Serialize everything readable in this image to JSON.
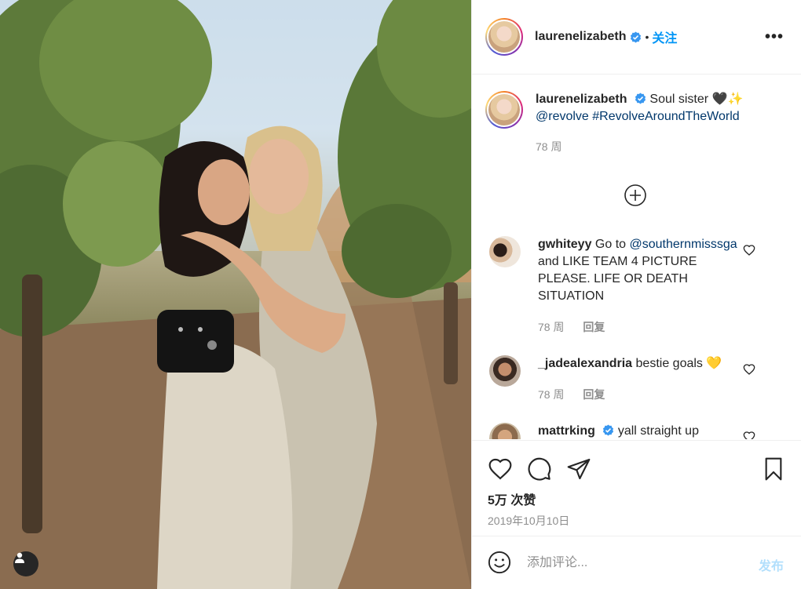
{
  "post": {
    "username": "laurenelizabeth",
    "dot": "•",
    "follow_label": "关注",
    "more_label": "•••"
  },
  "caption": {
    "username": "laurenelizabeth",
    "text": "Soul sister",
    "emojis": "🖤✨",
    "mention": "@revolve",
    "hashtag": "#RevolveAroundTheWorld",
    "time": "78 周"
  },
  "comments": [
    {
      "username": "gwhiteyy",
      "text_before": "Go to",
      "mention": "@southernmisssga",
      "text_after": "and LIKE TEAM 4 PICTURE PLEASE. LIFE OR DEATH SITUATION",
      "time": "78 周",
      "reply": "回复"
    },
    {
      "username": "_jadealexandria",
      "text": "bestie goals",
      "emoji": "💛",
      "time": "78 周",
      "reply": "回复"
    },
    {
      "username": "mattrking",
      "text": "yall straight up"
    }
  ],
  "stats": {
    "likes": "5万 次赞",
    "date": "2019年10月10日"
  },
  "composer": {
    "placeholder": "添加评论...",
    "post_label": "发布"
  },
  "colors": {
    "link": "#00376b",
    "follow": "#0095f6",
    "verified": "#3897f0",
    "muted": "#8e8e8e",
    "post_disabled": "#b2dffc"
  }
}
